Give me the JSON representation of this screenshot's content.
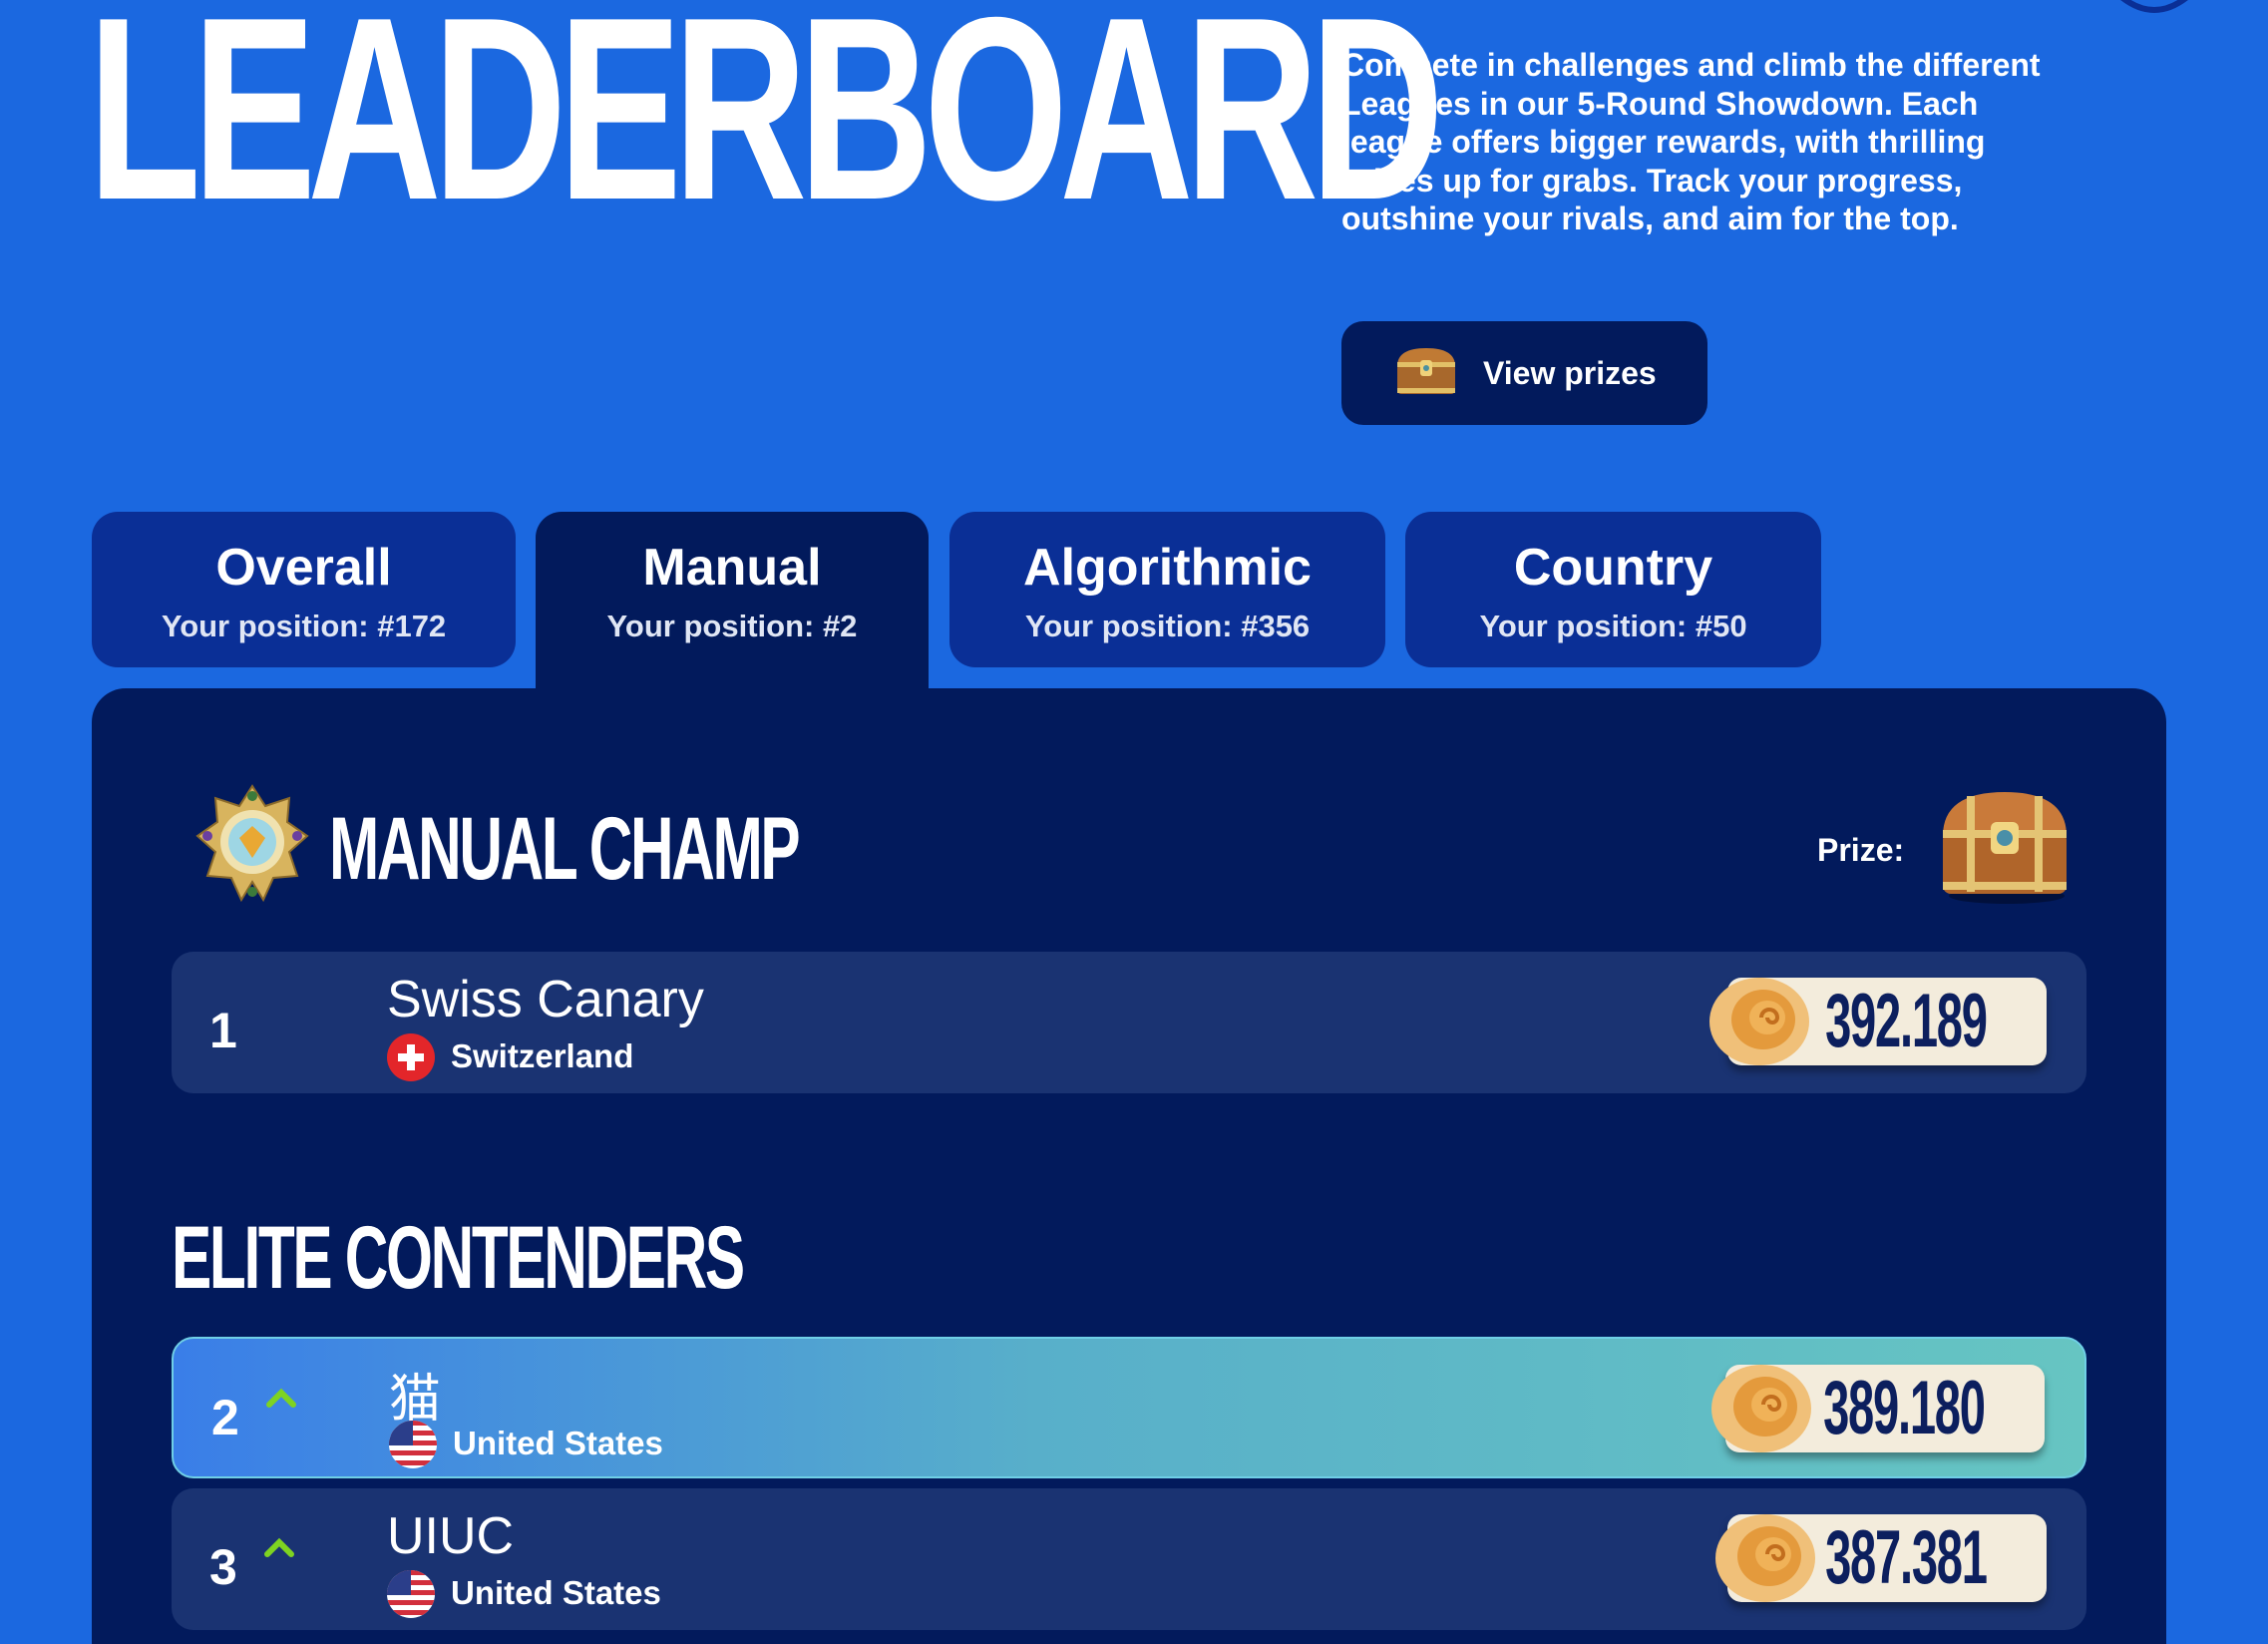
{
  "header": {
    "title": "LEADERBOARD",
    "description": "Compete in challenges and climb the different Leagues in our 5-Round Showdown. Each league offers bigger rewards, with thrilling prizes up for grabs. Track your progress, outshine your rivals, and aim for the top.",
    "prizes_button": "View prizes"
  },
  "tabs": [
    {
      "title": "Overall",
      "position": "Your position: #172",
      "active": false
    },
    {
      "title": "Manual",
      "position": "Your position: #2",
      "active": true
    },
    {
      "title": "Algorithmic",
      "position": "Your position: #356",
      "active": false
    },
    {
      "title": "Country",
      "position": "Your position: #50",
      "active": false
    }
  ],
  "champ": {
    "heading": "MANUAL CHAMP",
    "prize_label": "Prize:"
  },
  "elite": {
    "heading": "ELITE CONTENDERS"
  },
  "rows": [
    {
      "rank": "1",
      "name": "Swiss Canary",
      "country": "Switzerland",
      "score": "392.189",
      "trend": ""
    },
    {
      "rank": "2",
      "name": "猫",
      "country": "United States",
      "score": "389.180",
      "trend": "up"
    },
    {
      "rank": "3",
      "name": "UIUC",
      "country": "United States",
      "score": "387.381",
      "trend": "up"
    }
  ],
  "colors": {
    "background": "#1b68e0",
    "panel": "#021a5c",
    "tab": "#0a2f96",
    "row": "#1a3372",
    "trend_up": "#7ed321",
    "score_pill": "#f3ecdc"
  },
  "icons": {
    "prizes_button": "treasure-chest-icon",
    "champ_badge": "star-medal-icon",
    "prize": "treasure-chest-icon",
    "score": "shell-icon",
    "trend": "chevron-up-icon"
  }
}
